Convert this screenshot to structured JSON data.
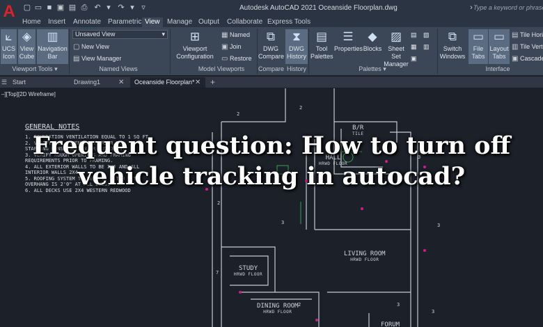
{
  "app": {
    "title": "Autodesk AutoCAD 2021  Oceanside Floorplan.dwg",
    "search_placeholder": "Type a keyword or phrase",
    "logo_letter": "A"
  },
  "quick_access": [
    "new-file-icon",
    "open-file-icon",
    "save-icon",
    "save-as-icon",
    "plot-icon",
    "undo-icon",
    "redo-icon"
  ],
  "ribbon_tabs": [
    "Home",
    "Insert",
    "Annotate",
    "Parametric",
    "View",
    "Manage",
    "Output",
    "Collaborate",
    "Express Tools"
  ],
  "active_tab": "View",
  "ribbon": {
    "viewport_tools": {
      "ucs_icon": "UCS\nIcon",
      "view_cube": "View\nCube",
      "navigation_bar": "Navigation\nBar",
      "label": "Viewport Tools"
    },
    "named_views": {
      "unsaved_view": "Unsaved View",
      "new_view": "New View",
      "view_manager": "View Manager",
      "label": "Named Views"
    },
    "model_viewports": {
      "viewport_configuration": "Viewport\nConfiguration",
      "named": "Named",
      "join": "Join",
      "restore": "Restore",
      "label": "Model Viewports"
    },
    "compare": {
      "dwg_compare": "DWG\nCompare",
      "label": "Compare"
    },
    "history": {
      "dwg_history": "DWG\nHistory",
      "label": "History"
    },
    "palettes": {
      "tool_palettes": "Tool\nPalettes",
      "properties": "Properties",
      "blocks": "Blocks",
      "sheet_set_manager": "Sheet Set\nManager",
      "label": "Palettes"
    },
    "interface": {
      "switch_windows": "Switch\nWindows",
      "file_tabs": "File\nTabs",
      "layout_tabs": "Layout\nTabs",
      "tile_horizontally": "Tile Hori",
      "tile_vertically": "Tile Verti",
      "cascade": "Cascade",
      "label": "Interface"
    }
  },
  "doc_tabs": [
    "Start",
    "Drawing1",
    "Oceanside Floorplan*"
  ],
  "viewport_label": "–][Top][2D Wireframe]",
  "notes": {
    "title": "GENERAL NOTES",
    "lines": [
      "1.  FOUNDATION VENTILATION EQUAL TO 1 SQ FT",
      "2.  VERIFY ALL DIMENSIONS PRIOR TO",
      "    STARTING CONSTRUCTION OR BUILDING.",
      "3.  VERIFY ROUGH OPENINGS AND FRAMING",
      "    REQUIREMENTS PRIOR TO FRAMING.",
      "4.  ALL EXTERIOR WALLS TO BE 2X6 AND ALL",
      "    INTERIOR WALLS 2X4.",
      "5.  ROOFING SYSTEM TO BE 5/12 PITCH WITH",
      "    OVERHANG IS 2'0\" AT ALL EVES.",
      "6.  ALL DECKS USE 2X4 WESTERN REDWOOD"
    ]
  },
  "rooms": [
    {
      "name": "B/R",
      "floor": "TILE"
    },
    {
      "name": "HALL",
      "floor": "HRWD FLOOR"
    },
    {
      "name": "LIVING ROOM",
      "floor": "HRWD FLOOR"
    },
    {
      "name": "STUDY",
      "floor": "HRWD FLOOR"
    },
    {
      "name": "DINING ROOM",
      "floor": "HRWD FLOOR"
    },
    {
      "name": "FORUM",
      "floor": ""
    }
  ],
  "dimension_tags": [
    "2",
    "2",
    "3",
    "3",
    "3",
    "3",
    "2",
    "7",
    "3",
    "2",
    "3"
  ],
  "headline": "Frequent question: How to turn off vehicle tracking in autocad?",
  "colors": {
    "accent_red": "#d8232a",
    "ribbon_bg": "#3b4657",
    "canvas_bg": "#1c2029"
  }
}
